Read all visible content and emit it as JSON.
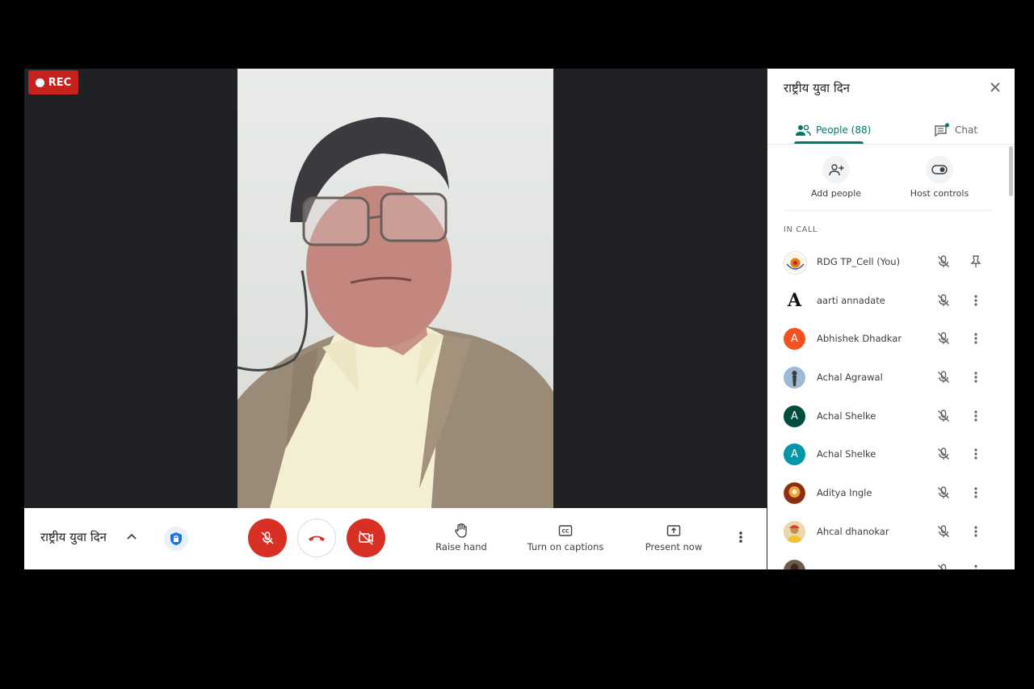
{
  "recording": {
    "label": "REC"
  },
  "meeting": {
    "title": "राष्ट्रीय युवा दिन"
  },
  "controls": {
    "raise_hand": "Raise hand",
    "captions": "Turn on captions",
    "present": "Present now"
  },
  "panel": {
    "title": "राष्ट्रीय युवा दिन",
    "tabs": [
      {
        "label": "People (88)"
      },
      {
        "label": "Chat"
      }
    ],
    "actions": [
      {
        "label": "Add people"
      },
      {
        "label": "Host controls"
      }
    ],
    "section_label": "IN CALL",
    "participants": [
      {
        "name": "RDG TP_Cell (You)",
        "avatar": "logo",
        "trailing": "pin-icon"
      },
      {
        "name": "aarti annadate",
        "avatar": "letter",
        "initial": "A",
        "color": "#ffffff",
        "trailing": "more-icon"
      },
      {
        "name": "Abhishek Dhadkar",
        "avatar": "letter",
        "initial": "A",
        "color": "#f4511e",
        "trailing": "more-icon"
      },
      {
        "name": "Achal Agrawal",
        "avatar": "photo",
        "color": "#9fb8d3",
        "trailing": "more-icon"
      },
      {
        "name": "Achal Shelke",
        "avatar": "letter",
        "initial": "A",
        "color": "#004d40",
        "trailing": "more-icon"
      },
      {
        "name": "Achal Shelke",
        "avatar": "letter",
        "initial": "A",
        "color": "#0097a7",
        "trailing": "more-icon"
      },
      {
        "name": "Aditya Ingle",
        "avatar": "photo",
        "color": "#c0642a",
        "trailing": "more-icon"
      },
      {
        "name": "Ahcal dhanokar",
        "avatar": "photo",
        "color": "#d8b36a",
        "trailing": "more-icon"
      },
      {
        "name": "",
        "avatar": "photo",
        "color": "#6d5b4d",
        "trailing": "more-icon"
      }
    ]
  },
  "colors": {
    "accent": "#00796b",
    "danger": "#d93025",
    "rec": "#c5221f",
    "stage_bg": "#202124"
  }
}
